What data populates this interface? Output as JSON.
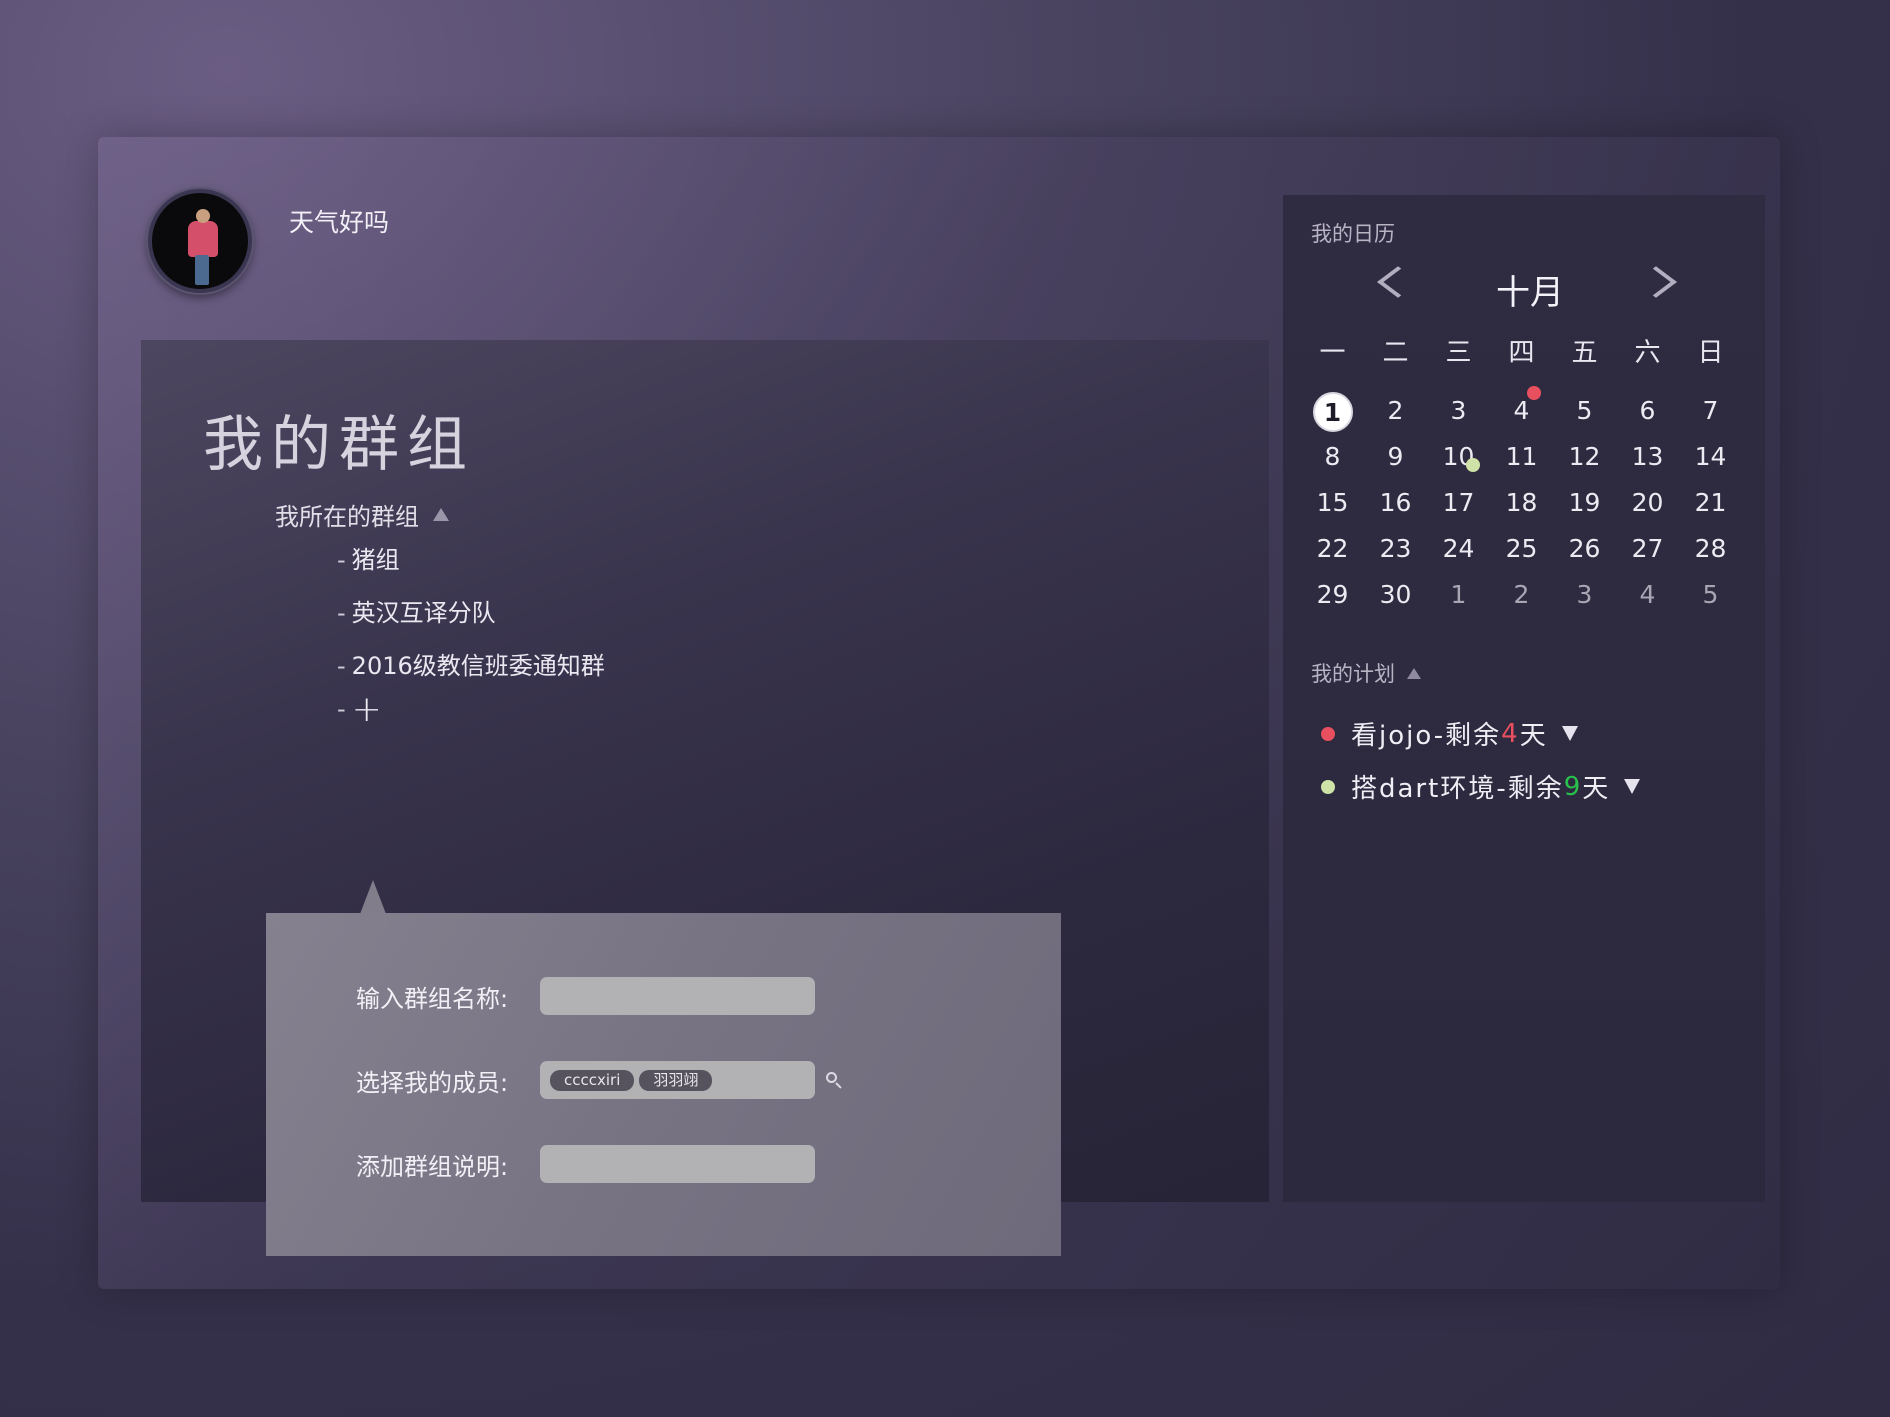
{
  "profile": {
    "username": "天气好吗"
  },
  "groups": {
    "title": "我的群组",
    "my_groups_label": "我所在的群组",
    "items": [
      {
        "label": "猪组"
      },
      {
        "label": "英汉互译分队"
      },
      {
        "label": "2016级教信班委通知群"
      }
    ],
    "add_label": "+",
    "dash": "-"
  },
  "form": {
    "group_name_label": "输入群组名称:",
    "group_name_value": "",
    "members_label": "选择我的成员:",
    "members": [
      "ccccxiri",
      "羽羽翊"
    ],
    "description_label": "添加群组说明:",
    "description_value": ""
  },
  "calendar": {
    "title": "我的日历",
    "month": "十月",
    "weekdays": [
      "一",
      "二",
      "三",
      "四",
      "五",
      "六",
      "日"
    ],
    "days": [
      {
        "d": "1",
        "today": true
      },
      {
        "d": "2"
      },
      {
        "d": "3"
      },
      {
        "d": "4",
        "dot": "#e8505f"
      },
      {
        "d": "5"
      },
      {
        "d": "6"
      },
      {
        "d": "7"
      },
      {
        "d": "8"
      },
      {
        "d": "9"
      },
      {
        "d": "10",
        "dot": "#cfe3a8"
      },
      {
        "d": "11"
      },
      {
        "d": "12"
      },
      {
        "d": "13"
      },
      {
        "d": "14"
      },
      {
        "d": "15"
      },
      {
        "d": "16"
      },
      {
        "d": "17"
      },
      {
        "d": "18"
      },
      {
        "d": "19"
      },
      {
        "d": "20"
      },
      {
        "d": "21"
      },
      {
        "d": "22"
      },
      {
        "d": "23"
      },
      {
        "d": "24"
      },
      {
        "d": "25"
      },
      {
        "d": "26"
      },
      {
        "d": "27"
      },
      {
        "d": "28"
      },
      {
        "d": "29"
      },
      {
        "d": "30"
      },
      {
        "d": "1",
        "other": true
      },
      {
        "d": "2",
        "other": true
      },
      {
        "d": "3",
        "other": true
      },
      {
        "d": "4",
        "other": true
      },
      {
        "d": "5",
        "other": true
      }
    ]
  },
  "plans": {
    "title": "我的计划",
    "items": [
      {
        "prefix": "看jojo-剩余",
        "days": "4",
        "suffix": "天",
        "color": "#e8505f",
        "days_color": "#e8505f"
      },
      {
        "prefix": "搭dart环境-剩余",
        "days": "9",
        "suffix": "天",
        "color": "#cfe3a8",
        "days_color": "#28c24a"
      }
    ]
  }
}
